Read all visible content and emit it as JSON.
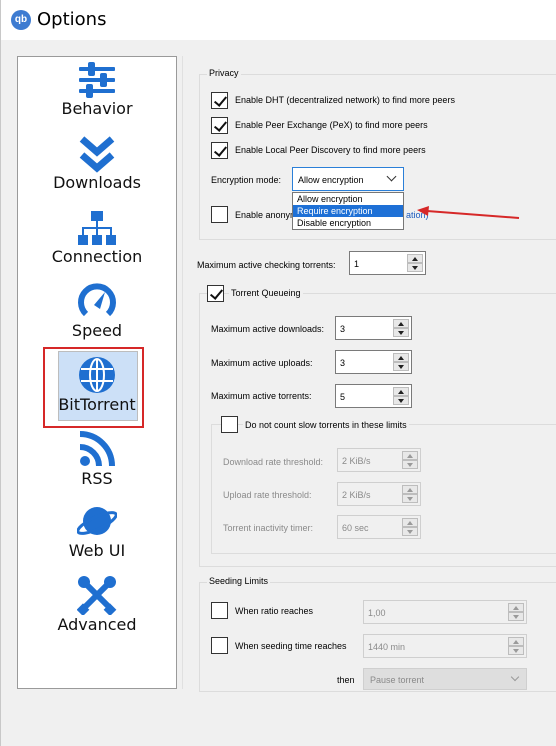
{
  "window": {
    "title": "Options",
    "app_icon_text": "qb"
  },
  "sidebar": {
    "items": [
      {
        "label": "Behavior",
        "icon": "sliders-icon"
      },
      {
        "label": "Downloads",
        "icon": "double-chevron-down-icon"
      },
      {
        "label": "Connection",
        "icon": "network-icon"
      },
      {
        "label": "Speed",
        "icon": "speedometer-icon"
      },
      {
        "label": "BitTorrent",
        "icon": "globe-icon",
        "selected": true
      },
      {
        "label": "RSS",
        "icon": "rss-icon"
      },
      {
        "label": "Web UI",
        "icon": "planet-icon"
      },
      {
        "label": "Advanced",
        "icon": "tools-icon"
      }
    ]
  },
  "privacy": {
    "title": "Privacy",
    "dht_label": "Enable DHT (decentralized network) to find more peers",
    "dht_checked": true,
    "pex_label": "Enable Peer Exchange (PeX) to find more peers",
    "pex_checked": true,
    "lpd_label": "Enable Local Peer Discovery to find more peers",
    "lpd_checked": true,
    "encryption_label": "Encryption mode:",
    "encryption_value": "Allow encryption",
    "encryption_options": [
      "Allow encryption",
      "Require encryption",
      "Disable encryption"
    ],
    "encryption_highlighted": "Require encryption",
    "anon_label": "Enable anonym",
    "anon_link": "ation)",
    "anon_checked": false
  },
  "checking": {
    "label": "Maximum active checking torrents:",
    "value": "1"
  },
  "queueing": {
    "title": "Torrent Queueing",
    "checked": true,
    "downloads_label": "Maximum active downloads:",
    "downloads_value": "3",
    "uploads_label": "Maximum active uploads:",
    "uploads_value": "3",
    "torrents_label": "Maximum active torrents:",
    "torrents_value": "5",
    "slow": {
      "label": "Do not count slow torrents in these limits",
      "checked": false,
      "dl_label": "Download rate threshold:",
      "dl_value": "2 KiB/s",
      "ul_label": "Upload rate threshold:",
      "ul_value": "2 KiB/s",
      "timer_label": "Torrent inactivity timer:",
      "timer_value": "60 sec"
    }
  },
  "seeding": {
    "title": "Seeding Limits",
    "ratio_label": "When ratio reaches",
    "ratio_value": "1,00",
    "ratio_checked": false,
    "time_label": "When seeding time reaches",
    "time_value": "1440 min",
    "time_checked": false,
    "then_label": "then",
    "then_value": "Pause torrent"
  },
  "colors": {
    "accent": "#1e70d6",
    "highlight_border": "#d62828",
    "selection_bg": "#cce0f7",
    "icon_blue": "#1f6fd0"
  }
}
